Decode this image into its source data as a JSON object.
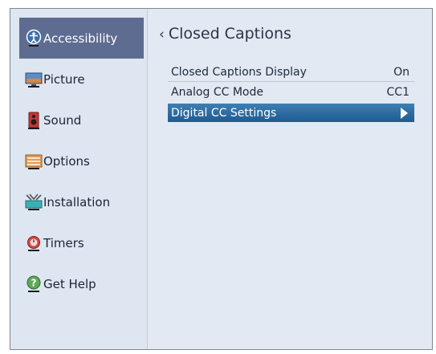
{
  "sidebar": {
    "items": [
      {
        "label": "Accessibility",
        "icon": "accessibility-icon"
      },
      {
        "label": "Picture",
        "icon": "picture-icon"
      },
      {
        "label": "Sound",
        "icon": "speaker-icon"
      },
      {
        "label": "Options",
        "icon": "options-icon"
      },
      {
        "label": "Installation",
        "icon": "installation-icon"
      },
      {
        "label": "Timers",
        "icon": "timer-icon"
      },
      {
        "label": "Get Help",
        "icon": "help-icon"
      }
    ],
    "active_index": 0
  },
  "main": {
    "title": "Closed Captions",
    "back_icon": "chevron-left-icon",
    "rows": [
      {
        "label": "Closed Captions Display",
        "value": "On"
      },
      {
        "label": "Analog CC Mode",
        "value": "CC1"
      },
      {
        "label": "Digital CC Settings",
        "value": "",
        "selected": true,
        "icon": "play-arrow-icon"
      }
    ]
  },
  "colors": {
    "background": "#e2e9f2",
    "sidebar_active": "#5e6c91",
    "row_selected": "#2b6aa0"
  }
}
